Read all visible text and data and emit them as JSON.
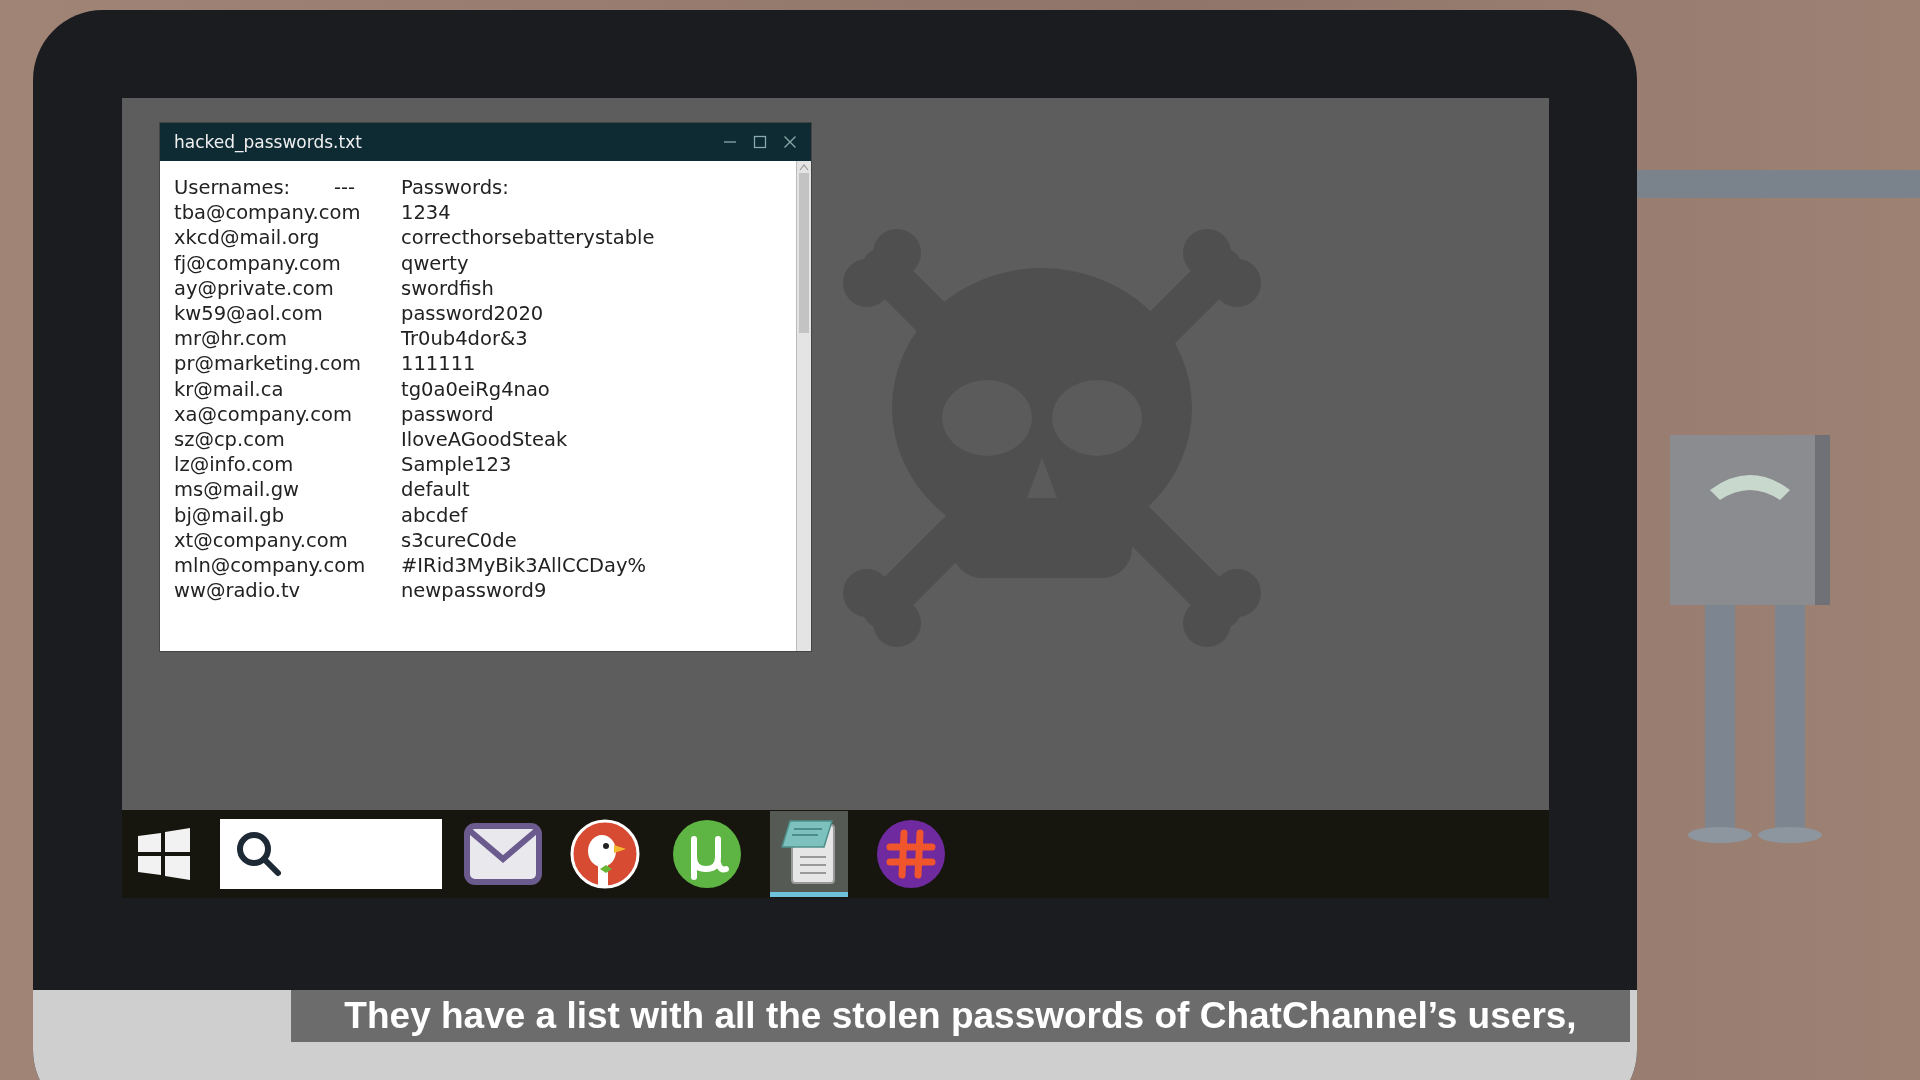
{
  "window": {
    "title": "hacked_passwords.txt"
  },
  "file": {
    "header": {
      "usernames": "Usernames:",
      "separator": "---",
      "passwords": "Passwords:"
    },
    "rows": [
      {
        "username": "tba@company.com",
        "password": "1234"
      },
      {
        "username": "xkcd@mail.org",
        "password": "correcthorsebatterystable"
      },
      {
        "username": "fj@company.com",
        "password": "qwerty"
      },
      {
        "username": "ay@private.com",
        "password": "swordfish"
      },
      {
        "username": "kw59@aol.com",
        "password": "password2020"
      },
      {
        "username": "mr@hr.com",
        "password": "Tr0ub4dor&3"
      },
      {
        "username": "pr@marketing.com",
        "password": "111111"
      },
      {
        "username": "kr@mail.ca",
        "password": "tg0a0eiRg4nao"
      },
      {
        "username": "xa@company.com",
        "password": "password"
      },
      {
        "username": "sz@cp.com",
        "password": "IloveAGoodSteak"
      },
      {
        "username": "lz@info.com",
        "password": "Sample123"
      },
      {
        "username": "ms@mail.gw",
        "password": "default"
      },
      {
        "username": "bj@mail.gb",
        "password": "abcdef"
      },
      {
        "username": "xt@company.com",
        "password": "s3cureC0de"
      },
      {
        "username": "mln@company.com",
        "password": "#IRid3MyBik3AllCCDay%"
      },
      {
        "username": "ww@radio.tv",
        "password": "newpassword9"
      }
    ]
  },
  "taskbar": {
    "apps": [
      {
        "kind": "mail",
        "selected": false
      },
      {
        "kind": "duck",
        "selected": false
      },
      {
        "kind": "torrent",
        "selected": false
      },
      {
        "kind": "notepad",
        "selected": true
      },
      {
        "kind": "chat",
        "selected": false
      }
    ]
  },
  "caption": "They have a list with all the stolen passwords of ChatChannel’s users,"
}
